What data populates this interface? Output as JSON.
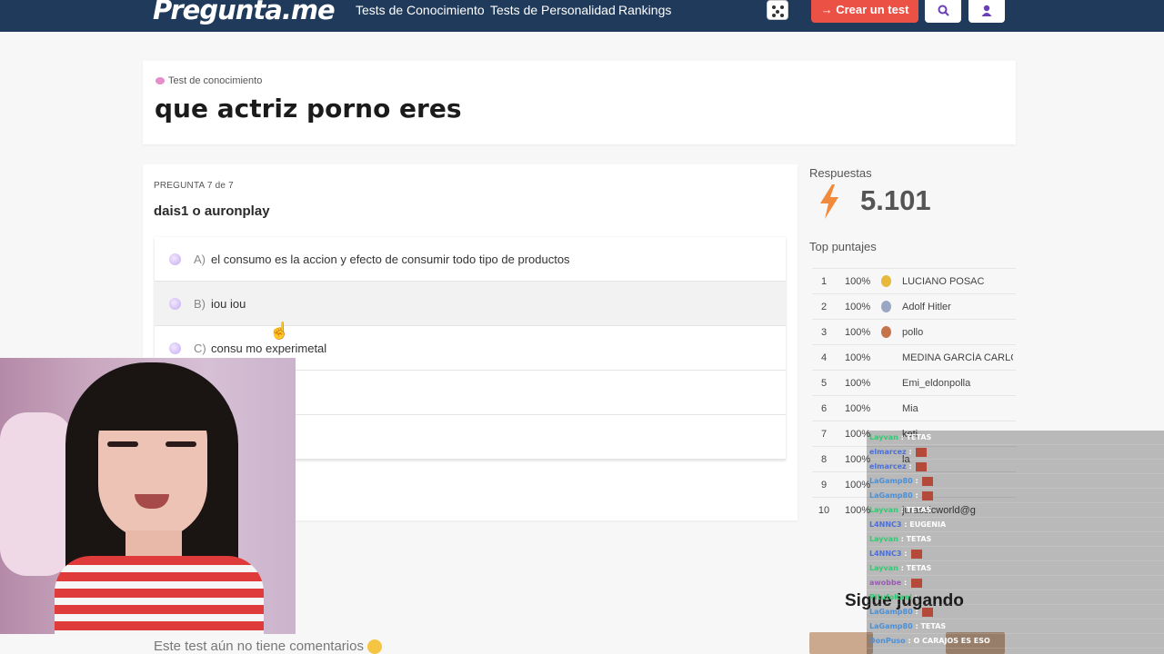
{
  "nav": {
    "logo": "Pregunta.me",
    "links": [
      "Tests de Conocimiento",
      "Tests de Personalidad",
      "Rankings"
    ],
    "create_label": "→ Crear un test",
    "search_icon": "search-icon",
    "user_icon": "user-icon",
    "dice_icon": "dice-icon"
  },
  "test": {
    "type_label": "Test de conocimiento",
    "title": "que actriz porno eres"
  },
  "question": {
    "counter": "PREGUNTA 7 de 7",
    "text": "dais1 o auronplay",
    "options": [
      {
        "letter": "A)",
        "text": "el consumo es la accion y efecto de consumir todo tipo de productos"
      },
      {
        "letter": "B)",
        "text": "iou iou"
      },
      {
        "letter": "C)",
        "text": "consu mo experimetal"
      }
    ]
  },
  "sidebar": {
    "responses_label": "Respuestas",
    "responses_count": "5.101",
    "top_label": "Top puntajes",
    "ranking": [
      {
        "num": "1",
        "pct": "100%",
        "medal": "gold",
        "name": "LUCIANO POSAC"
      },
      {
        "num": "2",
        "pct": "100%",
        "medal": "silver",
        "name": "Adolf Hitler"
      },
      {
        "num": "3",
        "pct": "100%",
        "medal": "bronze",
        "name": "pollo"
      },
      {
        "num": "4",
        "pct": "100%",
        "medal": "",
        "name": "MEDINA GARCÍA CARLOS"
      },
      {
        "num": "5",
        "pct": "100%",
        "medal": "",
        "name": "Emi_eldonpolla"
      },
      {
        "num": "6",
        "pct": "100%",
        "medal": "",
        "name": "Mia"
      },
      {
        "num": "7",
        "pct": "100%",
        "medal": "",
        "name": "keti"
      },
      {
        "num": "8",
        "pct": "100%",
        "medal": "",
        "name": "la"
      },
      {
        "num": "9",
        "pct": "100%",
        "medal": "",
        "name": ""
      },
      {
        "num": "10",
        "pct": "100%",
        "medal": "",
        "name": "jurassicworld@g"
      }
    ],
    "keep_playing": "Sigue jugando"
  },
  "comments": {
    "empty_text": "Este test aún no tiene comentarios"
  },
  "chat": [
    {
      "user": "Layvan",
      "color": "#2ecc71",
      "msg": "TETAS",
      "emote": false
    },
    {
      "user": "elmarcez",
      "color": "#4a6fd8",
      "msg": "",
      "emote": true
    },
    {
      "user": "elmarcez",
      "color": "#4a6fd8",
      "msg": "",
      "emote": true
    },
    {
      "user": "LaGamp80",
      "color": "#4a90d8",
      "msg": "",
      "emote": true
    },
    {
      "user": "LaGamp80",
      "color": "#4a90d8",
      "msg": "",
      "emote": true
    },
    {
      "user": "Layvan",
      "color": "#2ecc71",
      "msg": "TETAS",
      "emote": false
    },
    {
      "user": "L4NNC3",
      "color": "#4a6fd8",
      "msg": "EUGENIA",
      "emote": false
    },
    {
      "user": "Layvan",
      "color": "#2ecc71",
      "msg": "TETAS",
      "emote": false
    },
    {
      "user": "L4NNC3",
      "color": "#4a6fd8",
      "msg": "",
      "emote": true
    },
    {
      "user": "Layvan",
      "color": "#2ecc71",
      "msg": "TETAS",
      "emote": false
    },
    {
      "user": "awobbe",
      "color": "#9b59b6",
      "msg": "",
      "emote": true
    },
    {
      "user": "PitufoKael",
      "color": "#2ecc71",
      "msg": "",
      "emote": false
    },
    {
      "user": "LaGamp80",
      "color": "#4a90d8",
      "msg": "",
      "emote": true
    },
    {
      "user": "LaGamp80",
      "color": "#4a90d8",
      "msg": "TETAS",
      "emote": false
    },
    {
      "user": "DonPuso",
      "color": "#4a90d8",
      "msg": "O CARAJOS ES ESO",
      "emote": false
    }
  ]
}
